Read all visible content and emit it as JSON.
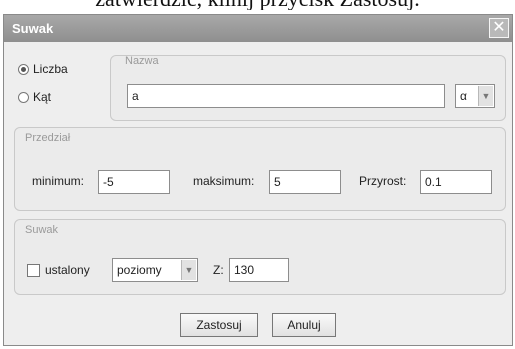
{
  "background_text": "zatwierdzić, klinij przycisk Zastosuj.",
  "dialog": {
    "title": "Suwak",
    "close_glyph": "✕",
    "type": {
      "number_label": "Liczba",
      "angle_label": "Kąt",
      "selected": "number"
    },
    "name": {
      "caption": "Nazwa",
      "value": "a",
      "symbol_value": "α"
    },
    "interval": {
      "caption": "Przedział",
      "min_label": "minimum:",
      "min_value": "-5",
      "max_label": "maksimum:",
      "max_value": "5",
      "step_label": "Przyrost:",
      "step_value": "0.1"
    },
    "slider": {
      "caption": "Suwak",
      "fixed_label": "ustalony",
      "orientation_value": "poziomy",
      "width_label": "Z:",
      "width_value": "130"
    },
    "buttons": {
      "apply": "Zastosuj",
      "cancel": "Anuluj"
    }
  }
}
